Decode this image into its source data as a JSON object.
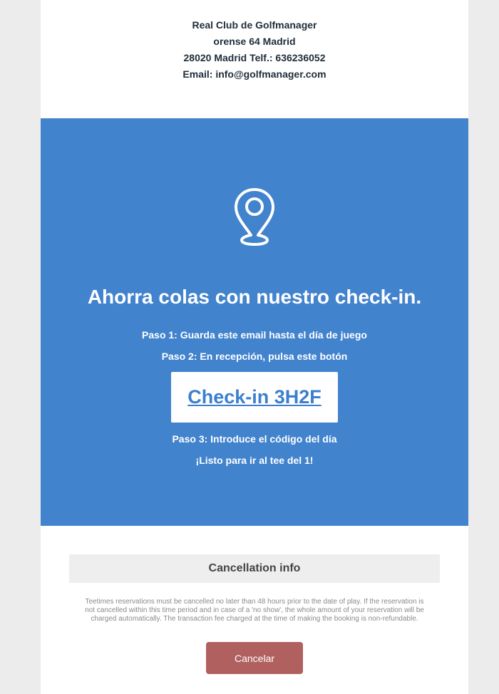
{
  "header": {
    "line1": "Real Club de Golfmanager",
    "line2": "orense 64 Madrid",
    "line3": "28020 Madrid Telf.: 636236052",
    "line4": "Email: info@golfmanager.com"
  },
  "hero": {
    "icon": "location-pin-icon",
    "title": "Ahorra colas con nuestro check-in.",
    "step1": "Paso 1: Guarda este email hasta el día de juego",
    "step2": "Paso 2: En recepción, pulsa este botón",
    "checkin_label": "Check-in 3H2F",
    "step3": "Paso 3: Introduce el código del día",
    "step4": "¡Listo para ir al tee del 1!",
    "background_color": "#4283ce"
  },
  "cancellation": {
    "title": "Cancellation info",
    "text": "Teetimes reservations must be cancelled no later than 48 hours prior to the date of play. If the reservation is not cancelled within this time period and in case of a 'no show', the whole amount of your reservation will be charged automatically. The transaction fee charged at the time of making the booking is non-refundable.",
    "button_label": "Cancelar",
    "button_color": "#b16060"
  }
}
